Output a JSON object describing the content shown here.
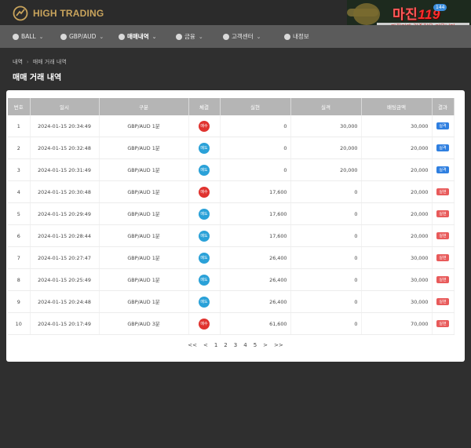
{
  "brand": {
    "name": "HIGH TRADING"
  },
  "ad_banner": {
    "title_part1": "마진",
    "title_part2": "119",
    "subtitle": "마진거래 검증전문 커뮤니티",
    "badge": "144"
  },
  "nav": [
    {
      "label": "BALL",
      "icon": "ball-icon",
      "chevron": true,
      "active": false
    },
    {
      "label": "GBP/AUD",
      "icon": "currency-icon",
      "chevron": true,
      "active": false
    },
    {
      "label": "매매내역",
      "icon": "chart-icon",
      "chevron": true,
      "active": true
    },
    {
      "label": "금융",
      "icon": "money-icon",
      "chevron": true,
      "active": false
    },
    {
      "label": "고객센터",
      "icon": "support-icon",
      "chevron": true,
      "active": false
    },
    {
      "label": "내정보",
      "icon": "user-icon",
      "chevron": false,
      "active": false
    }
  ],
  "breadcrumb": {
    "root": "내역",
    "sep": "›",
    "current": "매매 거래 내역"
  },
  "page_title": "매매 거래 내역",
  "table": {
    "headers": [
      "번호",
      "일시",
      "구분",
      "체결",
      "실현",
      "실격",
      "배팅금액",
      "결과"
    ],
    "rows": [
      {
        "no": "1",
        "time": "2024-01-15 20:34:49",
        "type": "GBP/AUD 1분",
        "side": "매수",
        "realized": "0",
        "loss": "30,000",
        "bet": "30,000",
        "result": "실격"
      },
      {
        "no": "2",
        "time": "2024-01-15 20:32:48",
        "type": "GBP/AUD 1분",
        "side": "매도",
        "realized": "0",
        "loss": "20,000",
        "bet": "20,000",
        "result": "실격"
      },
      {
        "no": "3",
        "time": "2024-01-15 20:31:49",
        "type": "GBP/AUD 1분",
        "side": "매도",
        "realized": "0",
        "loss": "20,000",
        "bet": "20,000",
        "result": "실격"
      },
      {
        "no": "4",
        "time": "2024-01-15 20:30:48",
        "type": "GBP/AUD 1분",
        "side": "매수",
        "realized": "17,600",
        "loss": "0",
        "bet": "20,000",
        "result": "실현"
      },
      {
        "no": "5",
        "time": "2024-01-15 20:29:49",
        "type": "GBP/AUD 1분",
        "side": "매도",
        "realized": "17,600",
        "loss": "0",
        "bet": "20,000",
        "result": "실현"
      },
      {
        "no": "6",
        "time": "2024-01-15 20:28:44",
        "type": "GBP/AUD 1분",
        "side": "매도",
        "realized": "17,600",
        "loss": "0",
        "bet": "20,000",
        "result": "실현"
      },
      {
        "no": "7",
        "time": "2024-01-15 20:27:47",
        "type": "GBP/AUD 1분",
        "side": "매도",
        "realized": "26,400",
        "loss": "0",
        "bet": "30,000",
        "result": "실현"
      },
      {
        "no": "8",
        "time": "2024-01-15 20:25:49",
        "type": "GBP/AUD 1분",
        "side": "매도",
        "realized": "26,400",
        "loss": "0",
        "bet": "30,000",
        "result": "실현"
      },
      {
        "no": "9",
        "time": "2024-01-15 20:24:48",
        "type": "GBP/AUD 1분",
        "side": "매도",
        "realized": "26,400",
        "loss": "0",
        "bet": "30,000",
        "result": "실현"
      },
      {
        "no": "10",
        "time": "2024-01-15 20:17:49",
        "type": "GBP/AUD 3분",
        "side": "매수",
        "realized": "61,600",
        "loss": "0",
        "bet": "70,000",
        "result": "실현"
      }
    ]
  },
  "pagination": [
    "<<",
    "<",
    "1",
    "2",
    "3",
    "4",
    "5",
    ">",
    ">>"
  ],
  "colors": {
    "buy": "#e0332f",
    "sell": "#2aa1d8",
    "loss_badge": "#2f7fe0",
    "win_badge": "#e85a5a",
    "brand": "#c9a45c"
  }
}
